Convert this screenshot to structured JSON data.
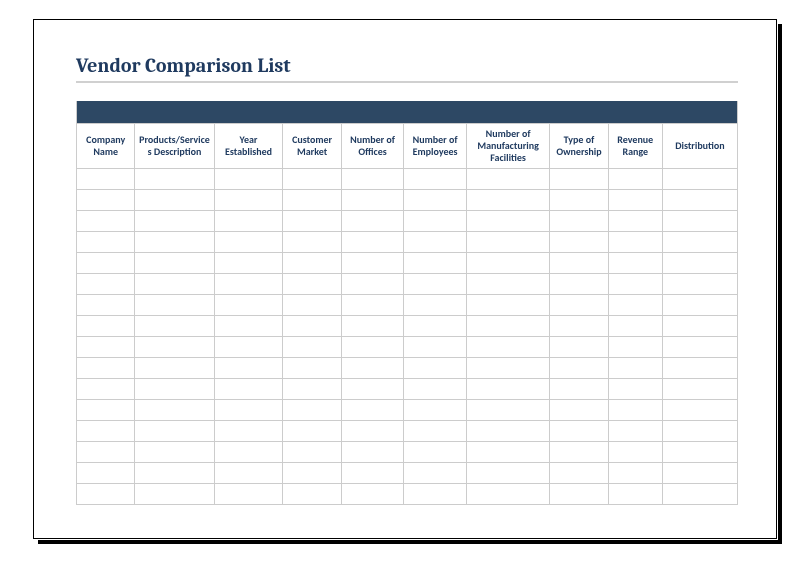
{
  "title": "Vendor Comparison List",
  "columns": [
    "Company Name",
    "Products/Services Description",
    "Year Established",
    "Customer Market",
    "Number of Offices",
    "Number of Employees",
    "Number of Manufacturing Facilities",
    "Type of Ownership",
    "Revenue Range",
    "Distribution"
  ],
  "rows": [
    [
      "",
      "",
      "",
      "",
      "",
      "",
      "",
      "",
      "",
      ""
    ],
    [
      "",
      "",
      "",
      "",
      "",
      "",
      "",
      "",
      "",
      ""
    ],
    [
      "",
      "",
      "",
      "",
      "",
      "",
      "",
      "",
      "",
      ""
    ],
    [
      "",
      "",
      "",
      "",
      "",
      "",
      "",
      "",
      "",
      ""
    ],
    [
      "",
      "",
      "",
      "",
      "",
      "",
      "",
      "",
      "",
      ""
    ],
    [
      "",
      "",
      "",
      "",
      "",
      "",
      "",
      "",
      "",
      ""
    ],
    [
      "",
      "",
      "",
      "",
      "",
      "",
      "",
      "",
      "",
      ""
    ],
    [
      "",
      "",
      "",
      "",
      "",
      "",
      "",
      "",
      "",
      ""
    ],
    [
      "",
      "",
      "",
      "",
      "",
      "",
      "",
      "",
      "",
      ""
    ],
    [
      "",
      "",
      "",
      "",
      "",
      "",
      "",
      "",
      "",
      ""
    ],
    [
      "",
      "",
      "",
      "",
      "",
      "",
      "",
      "",
      "",
      ""
    ],
    [
      "",
      "",
      "",
      "",
      "",
      "",
      "",
      "",
      "",
      ""
    ],
    [
      "",
      "",
      "",
      "",
      "",
      "",
      "",
      "",
      "",
      ""
    ],
    [
      "",
      "",
      "",
      "",
      "",
      "",
      "",
      "",
      "",
      ""
    ],
    [
      "",
      "",
      "",
      "",
      "",
      "",
      "",
      "",
      "",
      ""
    ],
    [
      "",
      "",
      "",
      "",
      "",
      "",
      "",
      "",
      "",
      ""
    ]
  ]
}
